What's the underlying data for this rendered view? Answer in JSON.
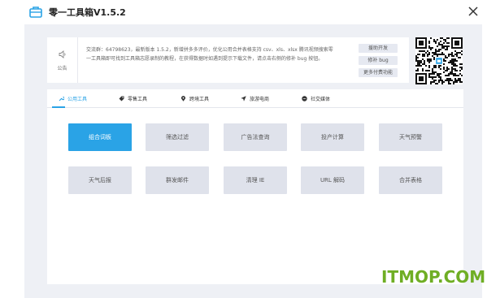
{
  "window": {
    "title": "零一工具箱V1.5.2",
    "app_icon": "toolbox-icon",
    "close_icon": "close-icon"
  },
  "notice": {
    "label": "公告",
    "icon": "speaker-icon",
    "line1": "交流群：64798623，最新版本 1.5.2，新增拼多多评价，优化公用合并表格支持 csv、xls、xlsx 腾讯视频搜索零",
    "line2": "一工具箱即可找到工具箱志愿录制的教程，在获得数据时如遇到提示下载文件，请点击右侧的修补 bug 按钮。",
    "buttons": [
      "援助开发",
      "修补 bug",
      "更多付费功能"
    ]
  },
  "qr_icon": "qr-code-icon",
  "tabs": [
    {
      "label": "公用工具",
      "icon": "wrench-icon",
      "active": true
    },
    {
      "label": "零售工具",
      "icon": "tag-icon",
      "active": false
    },
    {
      "label": "跨境工具",
      "icon": "location-pin-icon",
      "active": false
    },
    {
      "label": "旅游电商",
      "icon": "paper-plane-icon",
      "active": false
    },
    {
      "label": "社交媒体",
      "icon": "chat-icon",
      "active": false
    }
  ],
  "tools": {
    "row1": [
      "组合词板",
      "筛选过滤",
      "广告法查询",
      "投产计算",
      "天气预警"
    ],
    "row2": [
      "天气后报",
      "群发邮件",
      "清理 IE",
      "URL 解码",
      "合并表格"
    ]
  },
  "colors": {
    "accent": "#2aa3e6",
    "background": "#eef0f5",
    "tool_button": "#dfe2eb",
    "watermark": "#6fae24"
  },
  "watermark": "ITMOP.COM"
}
